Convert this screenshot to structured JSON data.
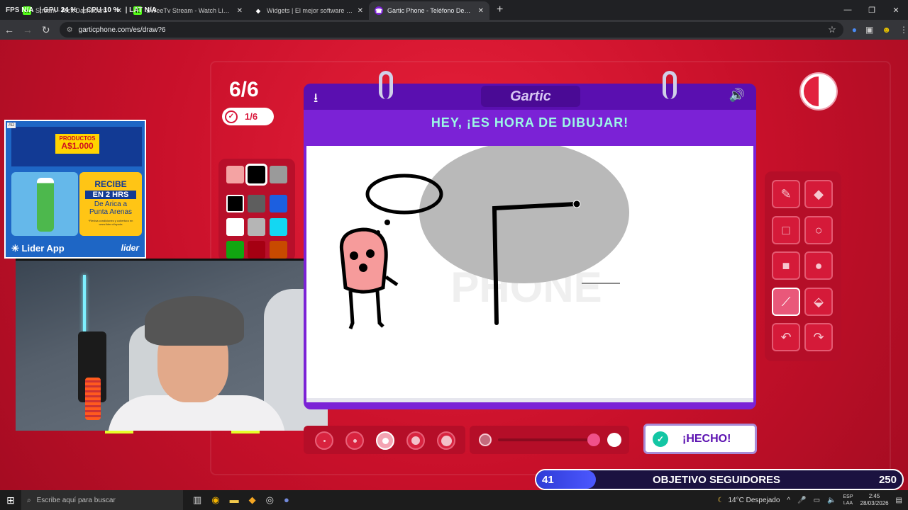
{
  "browser": {
    "hud": {
      "fps_label": "FPS",
      "fps": "N/A",
      "gpu_label": "GPU",
      "gpu": "24 %",
      "cpu_label": "CPU",
      "cpu": "10 %",
      "lat_label": "LAT",
      "lat": "N/A"
    },
    "tabs": [
      {
        "title": "Stream - Kick Dashboard",
        "icon": "kick-icon",
        "active": false
      },
      {
        "title": "SWeeTv Stream - Watch Live on",
        "icon": "kick-icon",
        "active": false
      },
      {
        "title": "Widgets | El mejor software para",
        "icon": "widgets-icon",
        "active": false
      },
      {
        "title": "Gartic Phone - Teléfono Descon",
        "icon": "gartic-icon",
        "active": true
      }
    ],
    "url": "garticphone.com/es/draw?6"
  },
  "game": {
    "round": "6/6",
    "done_count": "1/6",
    "logo": "Gartic",
    "prompt": "HEY, ¡ES HORA DE DIBUJAR!",
    "done_button": "¡HECHO!",
    "palette": [
      "#f4a3a3",
      "#000000",
      "#9a9a9a",
      "#000000",
      "#5e5e5e",
      "#1c5fe0",
      "#ffffff",
      "#b5b5b5",
      "#13d7f2",
      "#11a611",
      "#a50012",
      "#c84a00"
    ],
    "selected_color": "#000000",
    "brush_sizes": 5,
    "selected_brush_size": 3,
    "tools": [
      "pencil",
      "eraser",
      "rect-outline",
      "circle-outline",
      "rect-fill",
      "circle-fill",
      "line",
      "fill-bucket",
      "undo",
      "redo"
    ],
    "selected_tool": "line"
  },
  "ad": {
    "label": "AD",
    "badge_line1": "PRODUCTOS",
    "badge_price": "A$1.000",
    "promo_line1": "RECIBE",
    "promo_hrs": "EN 2 HRS",
    "promo_line3": "De Arica a",
    "promo_line4": "Punta Arenas",
    "promo_fine": "*Revisa condiciones y cobertura en www.lider.cl/ayuda",
    "footer": "Lider App",
    "brand": "lider"
  },
  "goal": {
    "current": "41",
    "label": "OBJETIVO SEGUIDORES",
    "target": "250",
    "progress": 0.16
  },
  "taskbar": {
    "search_placeholder": "Escribe aquí para buscar",
    "weather": "14°C  Despejado",
    "lang1": "ESP",
    "lang2": "LAA",
    "time": "2:45",
    "date": "28/03/2026"
  }
}
